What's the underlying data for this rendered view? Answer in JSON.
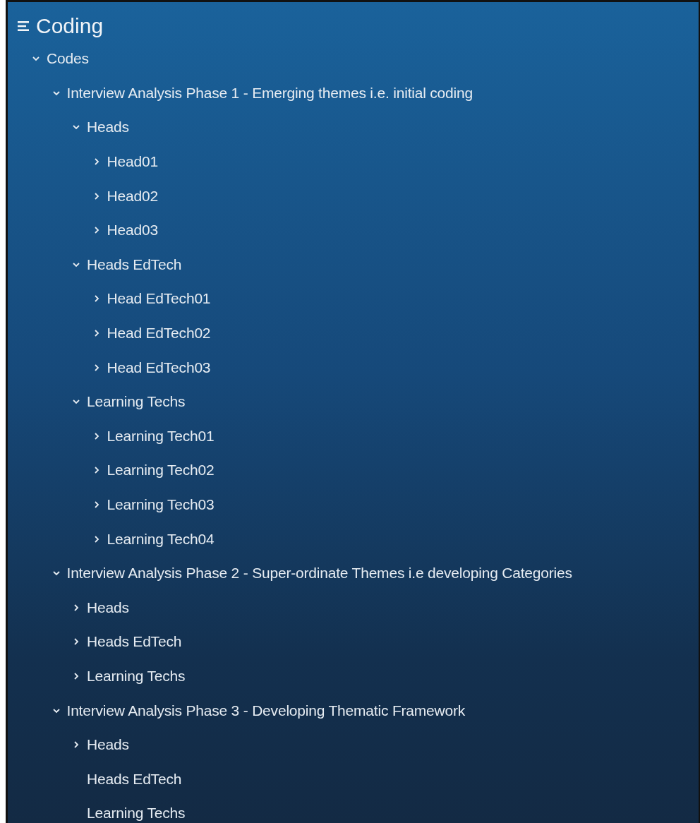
{
  "panel": {
    "title": "Coding"
  },
  "tree": [
    {
      "label": "Codes",
      "kind": "folder",
      "expanded": true,
      "children": [
        {
          "label": "Interview Analysis Phase 1 - Emerging themes i.e. initial coding",
          "kind": "folder",
          "expanded": true,
          "children": [
            {
              "label": "Heads",
              "kind": "folder",
              "expanded": true,
              "children": [
                {
                  "label": "Head01",
                  "kind": "folder",
                  "expanded": false
                },
                {
                  "label": "Head02",
                  "kind": "folder",
                  "expanded": false
                },
                {
                  "label": "Head03",
                  "kind": "folder",
                  "expanded": false
                }
              ]
            },
            {
              "label": "Heads EdTech",
              "kind": "folder",
              "expanded": true,
              "children": [
                {
                  "label": "Head EdTech01",
                  "kind": "folder",
                  "expanded": false
                },
                {
                  "label": "Head EdTech02",
                  "kind": "folder",
                  "expanded": false
                },
                {
                  "label": "Head EdTech03",
                  "kind": "folder",
                  "expanded": false
                }
              ]
            },
            {
              "label": "Learning Techs",
              "kind": "folder",
              "expanded": true,
              "children": [
                {
                  "label": "Learning Tech01",
                  "kind": "folder",
                  "expanded": false
                },
                {
                  "label": "Learning Tech02",
                  "kind": "folder",
                  "expanded": false
                },
                {
                  "label": "Learning Tech03",
                  "kind": "folder",
                  "expanded": false
                },
                {
                  "label": "Learning Tech04",
                  "kind": "folder",
                  "expanded": false
                }
              ]
            }
          ]
        },
        {
          "label": "Interview Analysis Phase 2 - Super-ordinate Themes i.e developing Categories",
          "kind": "folder",
          "expanded": true,
          "children": [
            {
              "label": "Heads",
              "kind": "folder",
              "expanded": false
            },
            {
              "label": "Heads EdTech",
              "kind": "folder",
              "expanded": false
            },
            {
              "label": "Learning Techs",
              "kind": "folder",
              "expanded": false
            }
          ]
        },
        {
          "label": "Interview Analysis Phase 3 - Developing Thematic Framework",
          "kind": "folder",
          "expanded": true,
          "children": [
            {
              "label": "Heads",
              "kind": "folder",
              "expanded": false
            },
            {
              "label": "Heads EdTech",
              "kind": "leaf"
            },
            {
              "label": "Learning Techs",
              "kind": "leaf"
            }
          ]
        }
      ]
    }
  ]
}
